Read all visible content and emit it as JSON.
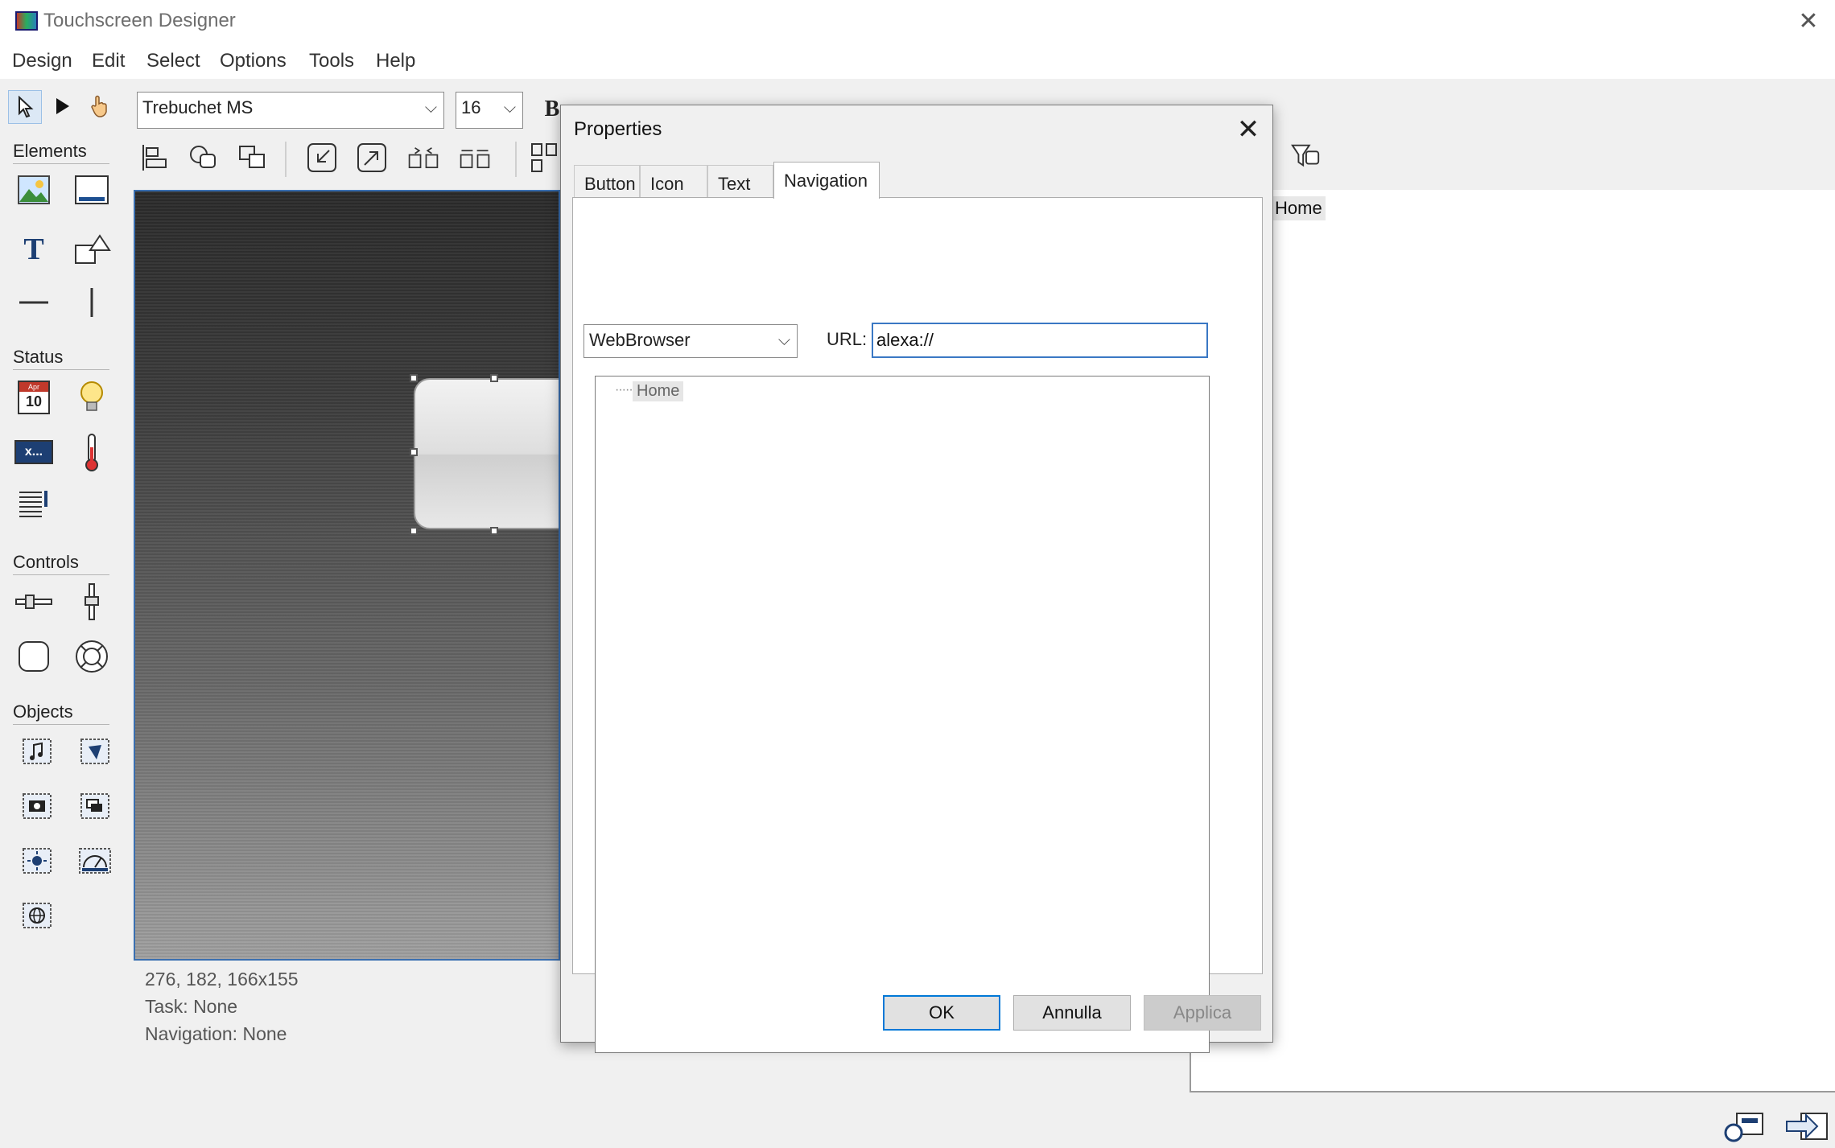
{
  "window": {
    "title": "Touchscreen Designer",
    "close_glyph": "✕"
  },
  "menu": {
    "items": [
      "Design",
      "Edit",
      "Select",
      "Options",
      "Tools",
      "Help"
    ]
  },
  "toolbar": {
    "font_family": "Trebuchet MS",
    "font_size": "16",
    "bold_label": "B"
  },
  "palette": {
    "elements_label": "Elements",
    "status_label": "Status",
    "controls_label": "Controls",
    "objects_label": "Objects",
    "calendar_month": "Apr",
    "calendar_day": "10",
    "variable_text": "x..."
  },
  "status_bar": {
    "geometry": "276, 182, 166x155",
    "task": "Task:  None",
    "navigation": "Navigation:  None"
  },
  "right_panel": {
    "home_label": "Home"
  },
  "dialog": {
    "title": "Properties",
    "close_glyph": "✕",
    "tabs": [
      "Button",
      "Icon",
      "Text",
      "Navigation"
    ],
    "active_tab": "Navigation",
    "browser_select": "WebBrowser",
    "url_label": "URL:",
    "url_value": "alexa://",
    "tree": {
      "dots": "·····",
      "home": "Home"
    },
    "buttons": {
      "ok": "OK",
      "cancel": "Annulla",
      "apply": "Applica"
    }
  },
  "colors": {
    "accent": "#0078d7",
    "canvas_border": "#3a6fb0"
  }
}
